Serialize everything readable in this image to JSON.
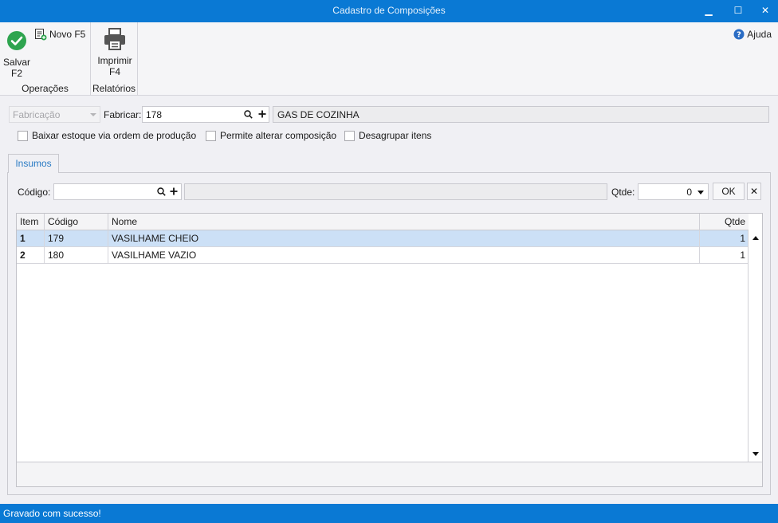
{
  "window": {
    "title": "Cadastro de Composições",
    "minimize_glyph": "▁",
    "maximize_glyph": "☐",
    "close_glyph": "✕"
  },
  "ribbon": {
    "groups": [
      {
        "label": "Operações"
      },
      {
        "label": "Relatórios"
      }
    ],
    "save_label_1": "Salvar",
    "save_label_2": "F2",
    "new_label": "Novo F5",
    "print_label_1": "Imprimir",
    "print_label_2": "F4",
    "help_label": "Ajuda",
    "colors": {
      "save_icon": "#2ea44f",
      "help_icon": "#2a6cc4"
    }
  },
  "form": {
    "type_select": "Fabricação",
    "fabricar_label": "Fabricar:",
    "fabricar_code": "178",
    "fabricar_name": "GAS DE COZINHA",
    "checkboxes": [
      {
        "label": "Baixar estoque via ordem de produção",
        "checked": false
      },
      {
        "label": "Permite alterar composição",
        "checked": false
      },
      {
        "label": "Desagrupar itens",
        "checked": false
      }
    ]
  },
  "tabs": [
    {
      "label": "Insumos",
      "active": true
    }
  ],
  "insumos": {
    "codigo_label": "Código:",
    "codigo_value": "",
    "name_value": "",
    "qtde_label": "Qtde:",
    "qtde_value": "0",
    "ok_label": "OK",
    "clear_glyph": "✕"
  },
  "grid": {
    "columns": [
      "Item",
      "Código",
      "Nome",
      "Qtde"
    ],
    "rows": [
      {
        "item": "1",
        "codigo": "179",
        "nome": "VASILHAME CHEIO",
        "qtde": "1",
        "selected": true
      },
      {
        "item": "2",
        "codigo": "180",
        "nome": "VASILHAME VAZIO",
        "qtde": "1",
        "selected": false
      }
    ]
  },
  "status": {
    "message": "Gravado com sucesso!"
  },
  "icons": {
    "search": "search-icon",
    "add": "plus-icon",
    "save": "checkmark-icon",
    "new": "new-document-icon",
    "print": "printer-icon",
    "help": "help-icon"
  }
}
